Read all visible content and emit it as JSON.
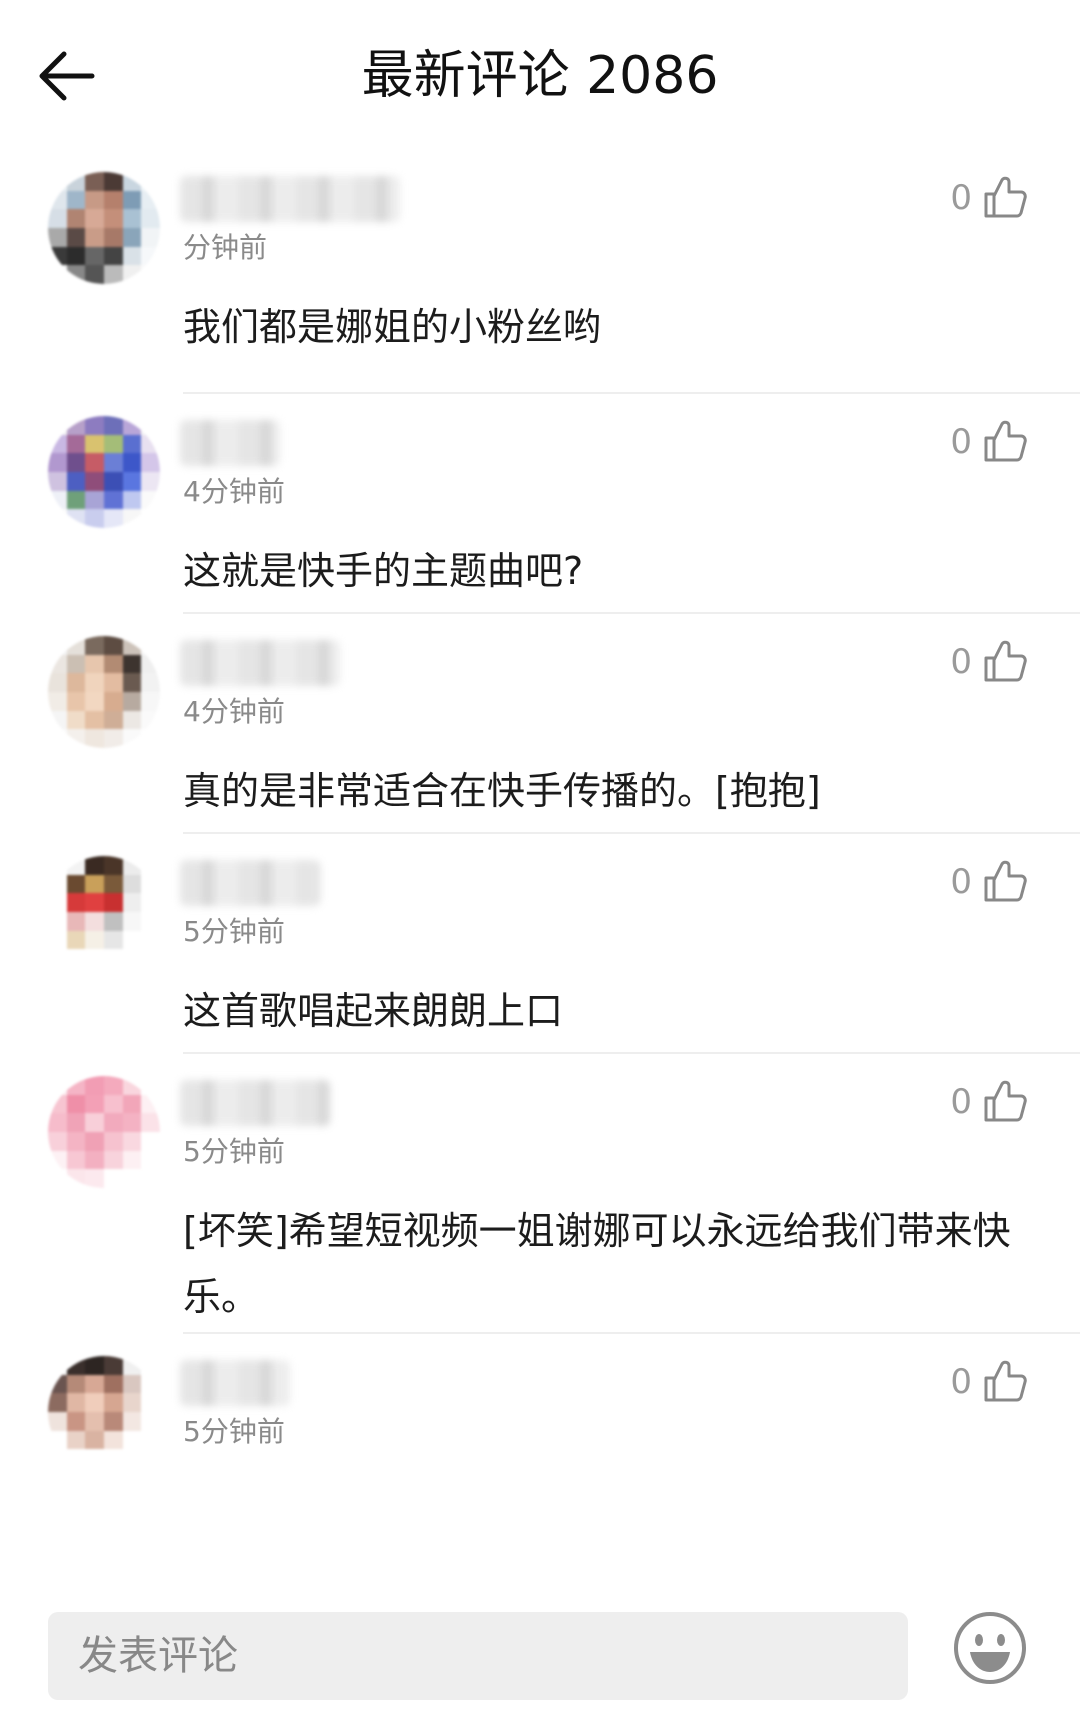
{
  "header": {
    "title": "最新评论 2086"
  },
  "comments": [
    {
      "time": "分钟前",
      "text": "我们都是娜姐的小粉丝哟",
      "likes": "0"
    },
    {
      "time": "4分钟前",
      "text": "这就是快手的主题曲吧?",
      "likes": "0"
    },
    {
      "time": "4分钟前",
      "text": "真的是非常适合在快手传播的。[抱抱]",
      "likes": "0"
    },
    {
      "time": "5分钟前",
      "text": "这首歌唱起来朗朗上口",
      "likes": "0"
    },
    {
      "time": "5分钟前",
      "text": "[坏笑]希望短视频一姐谢娜可以永远给我们带来快乐。",
      "likes": "0"
    },
    {
      "time": "5分钟前",
      "text": "",
      "likes": "0"
    }
  ],
  "bottom": {
    "placeholder": "发表评论"
  },
  "icons": {
    "back": "back-arrow-icon",
    "like": "thumbs-up-icon",
    "emoji": "smiley-icon"
  }
}
